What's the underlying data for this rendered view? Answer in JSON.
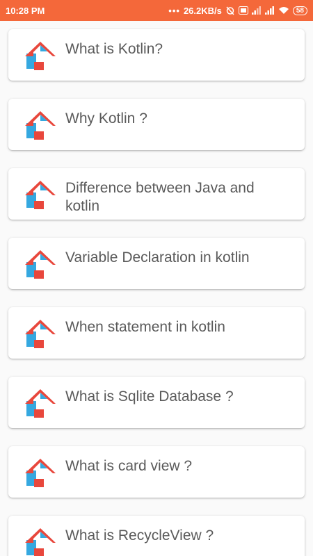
{
  "status_bar": {
    "time": "10:28 PM",
    "network_speed": "26.2KB/s",
    "battery_level": "58",
    "icons": [
      "dots-icon",
      "alarm-off-icon",
      "volte-icon",
      "signal-icon",
      "signal-icon",
      "wifi-icon",
      "battery-icon"
    ],
    "background_color": "#f4683a"
  },
  "list": {
    "items": [
      {
        "title": "What is Kotlin?",
        "icon": "kotlin-house-icon"
      },
      {
        "title": "Why Kotlin ?",
        "icon": "kotlin-house-icon"
      },
      {
        "title": "Difference between Java and kotlin",
        "icon": "kotlin-house-icon"
      },
      {
        "title": "Variable Declaration in kotlin",
        "icon": "kotlin-house-icon"
      },
      {
        "title": "When statement in kotlin",
        "icon": "kotlin-house-icon"
      },
      {
        "title": "What is Sqlite Database ?",
        "icon": "kotlin-house-icon"
      },
      {
        "title": "What is card view ?",
        "icon": "kotlin-house-icon"
      },
      {
        "title": "What is RecycleView ?",
        "icon": "kotlin-house-icon"
      }
    ]
  },
  "colors": {
    "icon_red": "#e8473c",
    "icon_blue": "#35a8e0",
    "text": "#5a5a5a"
  }
}
